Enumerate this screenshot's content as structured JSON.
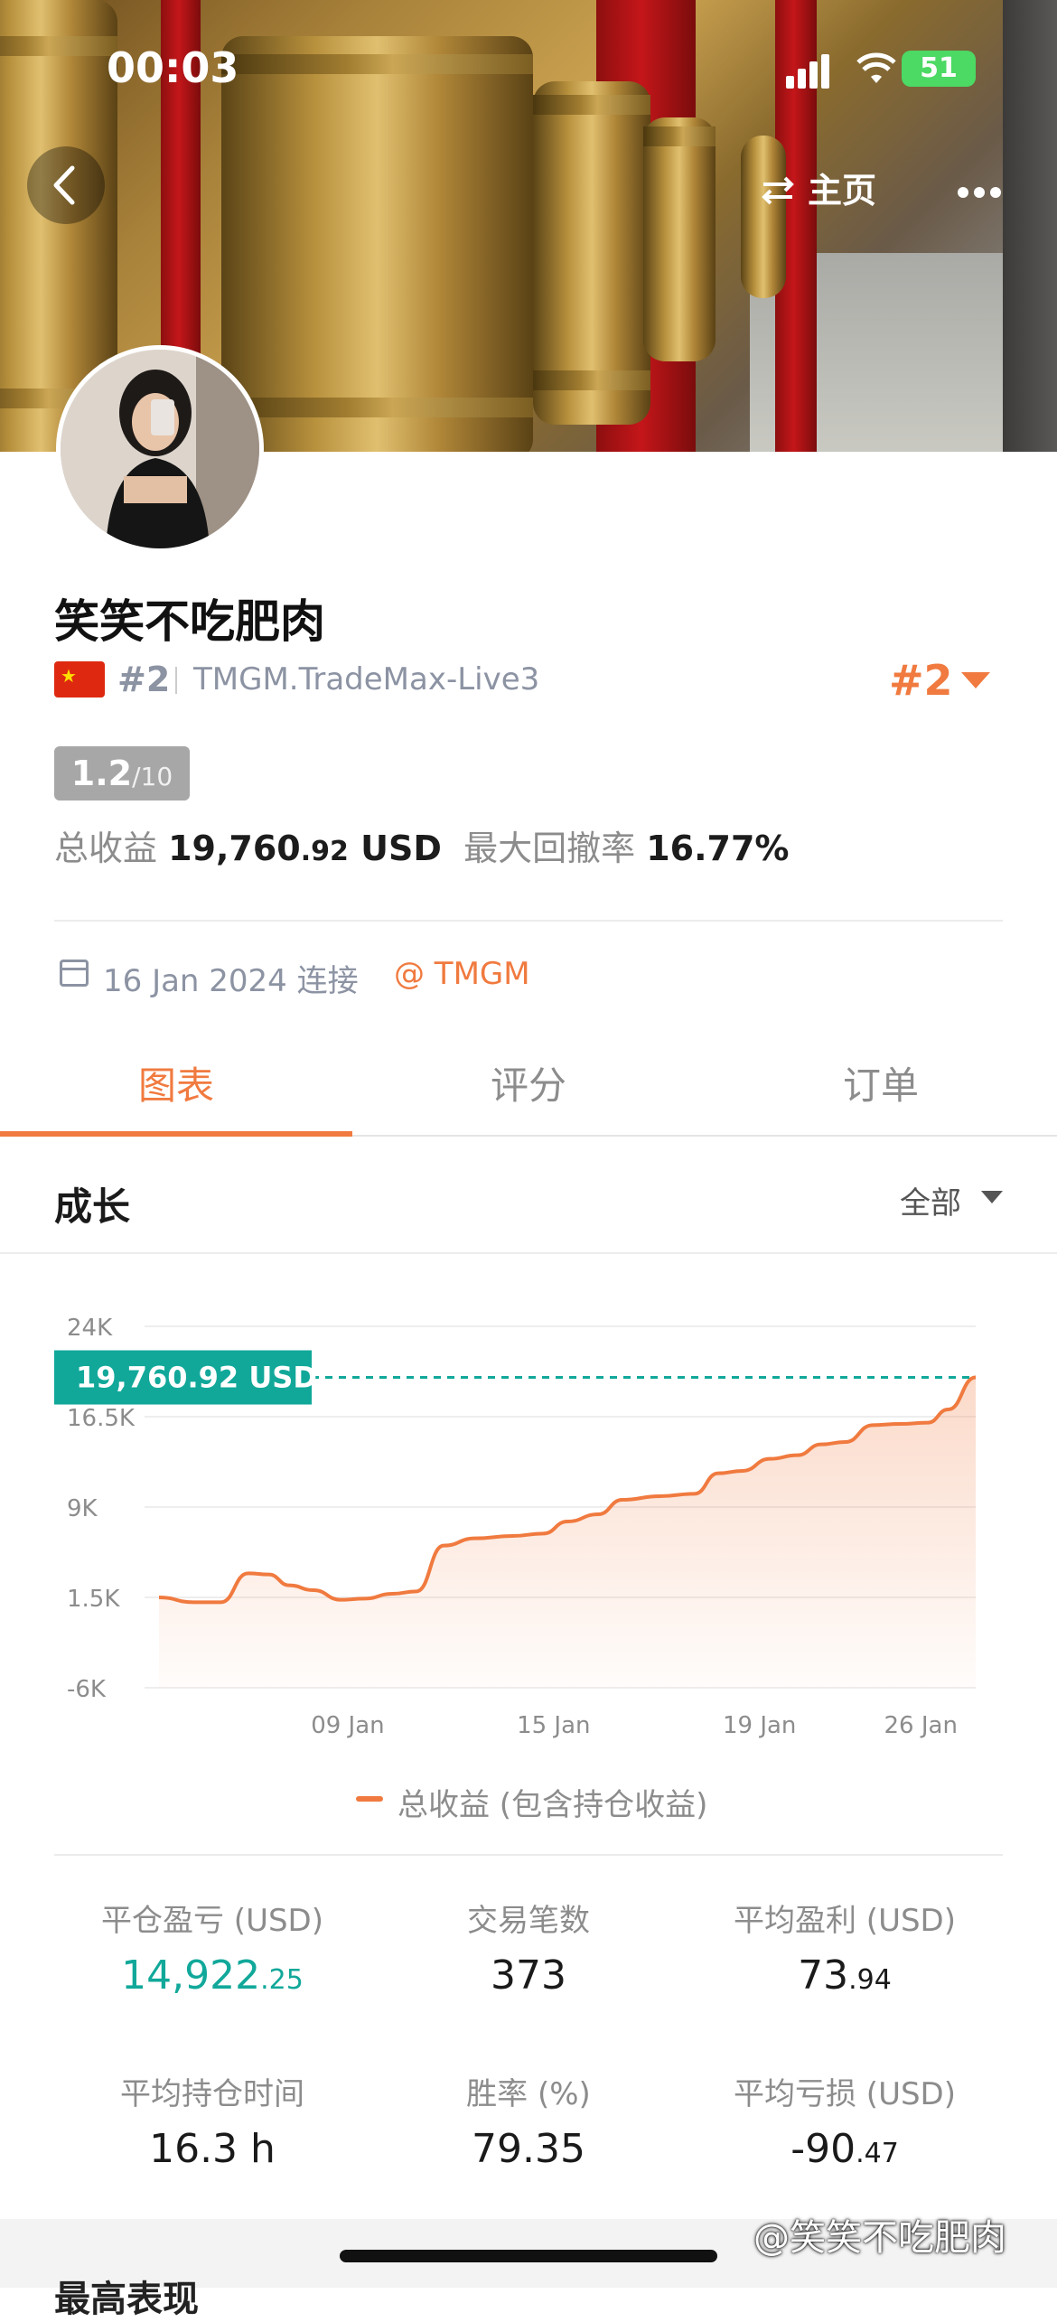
{
  "status_bar": {
    "time": "00:03",
    "battery": "51"
  },
  "nav": {
    "back_icon": "chevron-left-icon",
    "home_label": "主页",
    "swap_icon": "swap-icon",
    "more_icon": "ellipsis-icon"
  },
  "profile": {
    "name": "笑笑不吃肥肉",
    "flag": "china-flag-icon",
    "rank_small": "#2",
    "server": "TMGM.TradeMax-Live3",
    "rank_big": "#2",
    "score": "1.2",
    "score_max": "/10",
    "total_profit_label": "总收益",
    "total_profit_main": "19,760",
    "total_profit_decimal": ".92",
    "total_profit_unit": "USD",
    "max_drawdown_label": "最大回撤率",
    "max_drawdown_value": "16.77%",
    "connected_date": "16 Jan 2024 连接",
    "broker": "@ TMGM"
  },
  "tabs": [
    {
      "label": "图表",
      "active": true
    },
    {
      "label": "评分",
      "active": false
    },
    {
      "label": "订单",
      "active": false
    }
  ],
  "section": {
    "title": "成长",
    "filter": "全部"
  },
  "chart_data": {
    "type": "area",
    "series_name": "总收益 (包含持仓收益)",
    "current_label": "19,760.92 USD",
    "current_value": 19760.92,
    "y_ticks": [
      "24K",
      "16.5K",
      "9K",
      "1.5K",
      "-6K"
    ],
    "ylim": [
      -6000,
      24000
    ],
    "x_ticks": [
      "09 Jan",
      "15 Jan",
      "19 Jan",
      "26 Jan"
    ],
    "x_tick_positions": [
      5.5,
      11.5,
      17.5,
      22.2
    ],
    "x": [
      0,
      1,
      1.8,
      2.6,
      3.2,
      3.8,
      4.5,
      5.3,
      6.0,
      6.8,
      7.5,
      8.3,
      9.2,
      10.3,
      11.2,
      11.9,
      12.8,
      13.5,
      14.6,
      15.6,
      16.3,
      17.0,
      17.8,
      18.6,
      19.3,
      20.0,
      20.8,
      21.6,
      22.4,
      23.0,
      23.8
    ],
    "values": [
      1500,
      1100,
      1100,
      3500,
      3400,
      2500,
      2100,
      1300,
      1400,
      1800,
      2000,
      5800,
      6400,
      6600,
      6800,
      7800,
      8400,
      9600,
      9900,
      10100,
      11800,
      12000,
      13000,
      13300,
      14200,
      14400,
      15800,
      15900,
      16000,
      17100,
      19760.92
    ]
  },
  "metrics": [
    {
      "label": "平仓盈亏 (USD)",
      "main": "14,922",
      "dec": ".25",
      "color": "green"
    },
    {
      "label": "交易笔数",
      "main": "373",
      "dec": ""
    },
    {
      "label": "平均盈利 (USD)",
      "main": "73",
      "dec": ".94"
    },
    {
      "label": "平均持仓时间",
      "main": "16.3 h",
      "dec": ""
    },
    {
      "label": "胜率 (%)",
      "main": "79.35",
      "dec": ""
    },
    {
      "label": "平均亏损 (USD)",
      "main": "-90",
      "dec": ".47"
    }
  ],
  "watermark": "@笑笑不吃肥肉",
  "bottom_partial_title": "最高表现"
}
